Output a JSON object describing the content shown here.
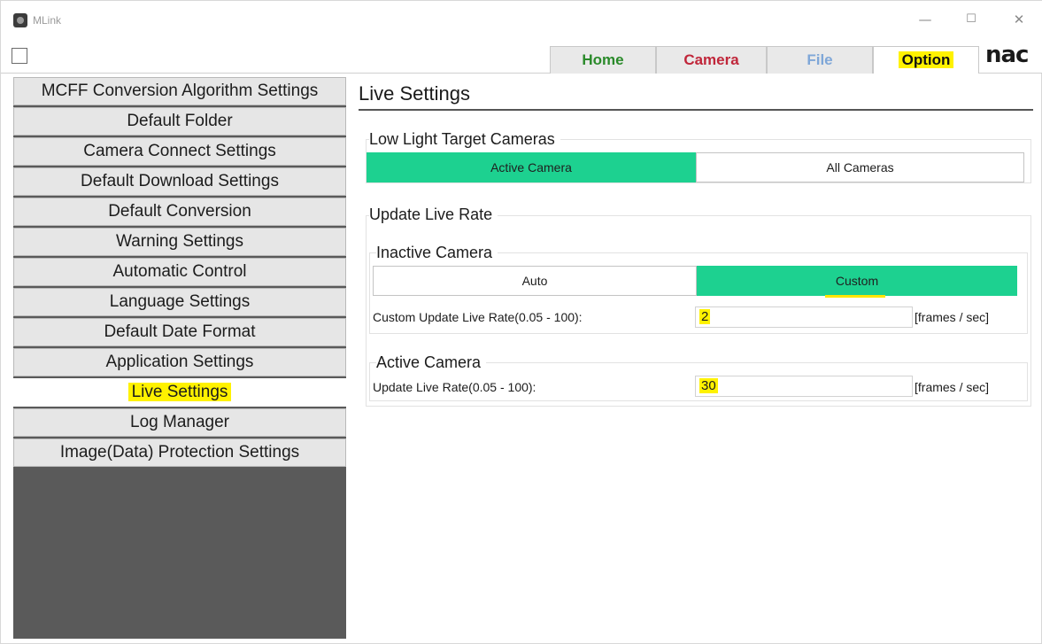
{
  "window": {
    "title": "MLink",
    "minimize_glyph": "—",
    "maximize_glyph": "☐",
    "close_glyph": "✕"
  },
  "toolbar": {
    "tabs": [
      {
        "label": "Home",
        "color": "#2a8a2a"
      },
      {
        "label": "Camera",
        "color": "#c0263a"
      },
      {
        "label": "File",
        "color": "#7fa7d8"
      },
      {
        "label": "Option",
        "color": "#111111",
        "selected": true
      }
    ],
    "brand": "nac"
  },
  "sidebar": {
    "items": [
      {
        "label": "MCFF Conversion Algorithm Settings"
      },
      {
        "label": "Default Folder"
      },
      {
        "label": "Camera Connect Settings"
      },
      {
        "label": "Default Download Settings"
      },
      {
        "label": "Default Conversion"
      },
      {
        "label": "Warning Settings"
      },
      {
        "label": "Automatic Control"
      },
      {
        "label": "Language Settings"
      },
      {
        "label": "Default Date Format"
      },
      {
        "label": "Application Settings"
      },
      {
        "label": "Live Settings",
        "selected": true
      },
      {
        "label": "Log Manager"
      },
      {
        "label": "Image(Data) Protection Settings"
      }
    ]
  },
  "main": {
    "title": "Live Settings",
    "low_light": {
      "title": "Low Light Target Cameras",
      "options": [
        "Active Camera",
        "All Cameras"
      ],
      "selected": "Active Camera"
    },
    "update_live_rate": {
      "title": "Update Live Rate",
      "inactive": {
        "title": "Inactive Camera",
        "options": [
          "Auto",
          "Custom"
        ],
        "selected": "Custom",
        "field_label": "Custom Update Live Rate(0.05 - 100):",
        "value": "2",
        "unit": "[frames / sec]"
      },
      "active": {
        "title": "Active Camera",
        "field_label": "Update Live Rate(0.05 - 100):",
        "value": "30",
        "unit": "[frames / sec]"
      }
    }
  },
  "colors": {
    "accent_green": "#1dd190",
    "highlight_yellow": "#fff200",
    "sidebar_bg": "#5a5a5a"
  }
}
